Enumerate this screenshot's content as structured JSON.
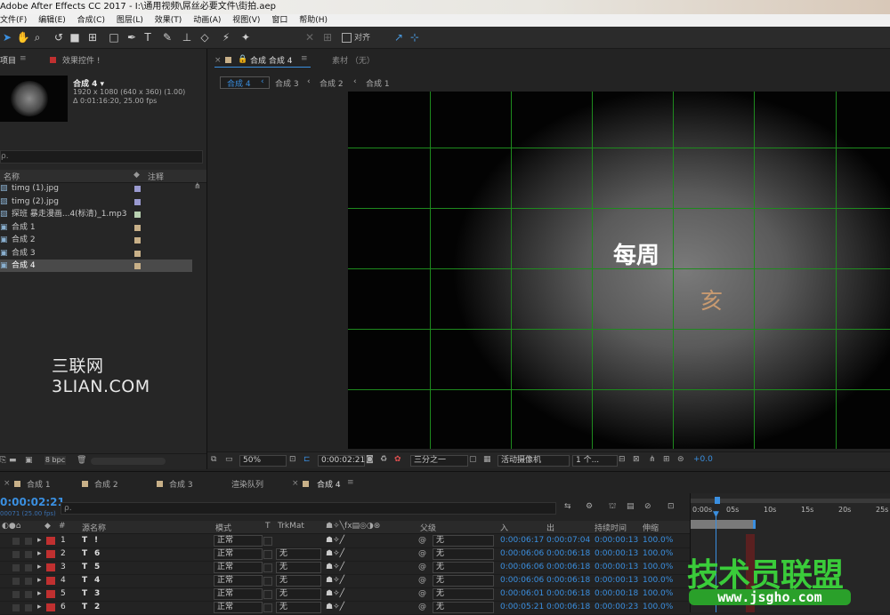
{
  "window": {
    "title": "Adobe After Effects CC 2017 - I:\\通用视频\\屌丝必要文件\\街拍.aep"
  },
  "menu": [
    "文件(F)",
    "编辑(E)",
    "合成(C)",
    "图层(L)",
    "效果(T)",
    "动画(A)",
    "视图(V)",
    "窗口",
    "帮助(H)"
  ],
  "toolbar": {
    "align_label": "对齐"
  },
  "project": {
    "tab_project": "项目",
    "tab_effects": "效果控件 !",
    "comp_name": "合成 4 ▾",
    "comp_size": "1920 x 1080  (640 x 360) (1.00)",
    "comp_duration": "Δ 0:01:16:20, 25.00 fps",
    "search_placeholder": "ρ.",
    "col_name": "名称",
    "col_comment": "注释",
    "items": [
      {
        "name": "timg (1).jpg",
        "color": "#9a9ad0"
      },
      {
        "name": "timg (2).jpg",
        "color": "#9a9ad0"
      },
      {
        "name": "探班 暴走漫画...4(标清)_1.mp3",
        "color": "#b8d0b0"
      },
      {
        "name": "合成 1",
        "color": "#c8b088"
      },
      {
        "name": "合成 2",
        "color": "#c8b088"
      },
      {
        "name": "合成 3",
        "color": "#c8b088"
      },
      {
        "name": "合成 4",
        "color": "#c8b088"
      }
    ],
    "bpc": "8 bpc"
  },
  "watermark": "三联网 3LIAN.COM",
  "viewer": {
    "tab_comp": "合成 合成 4",
    "tab_footage": "素材 （无）",
    "breadcrumbs": [
      "合成 4",
      "合成 3",
      "合成 2",
      "合成 1"
    ],
    "text_main": "每周",
    "text_sub": "亥",
    "zoom": "50%",
    "timecode": "0:00:02:21",
    "resolution": "三分之一",
    "camera": "活动摄像机",
    "views": "1 个...",
    "exposure": "+0.0"
  },
  "timeline": {
    "tabs": [
      "合成 1",
      "合成 2",
      "合成 3",
      "渲染队列",
      "合成 4"
    ],
    "timecode": "0:00:02:21",
    "fps_note": "00071 (25.00 fps)",
    "search_placeholder": "ρ.",
    "columns": {
      "num": "#",
      "source": "源名称",
      "mode": "模式",
      "t": "T",
      "trkmat": "TrkMat",
      "parent": "父级",
      "in": "入",
      "out": "出",
      "duration": "持续时间",
      "stretch": "伸缩"
    },
    "ruler": [
      "0:00s",
      "05s",
      "10s",
      "15s",
      "20s",
      "25s"
    ],
    "layers": [
      {
        "num": "1",
        "name": "!",
        "mode": "正常",
        "trkmat": "",
        "parent": "无",
        "in": "0:00:06:17",
        "out": "0:00:07:04",
        "duration": "0:00:00:13",
        "stretch": "100.0%"
      },
      {
        "num": "2",
        "name": "6",
        "mode": "正常",
        "trkmat": "无",
        "parent": "无",
        "in": "0:00:06:06",
        "out": "0:00:06:18",
        "duration": "0:00:00:13",
        "stretch": "100.0%"
      },
      {
        "num": "3",
        "name": "5",
        "mode": "正常",
        "trkmat": "无",
        "parent": "无",
        "in": "0:00:06:06",
        "out": "0:00:06:18",
        "duration": "0:00:00:13",
        "stretch": "100.0%"
      },
      {
        "num": "4",
        "name": "4",
        "mode": "正常",
        "trkmat": "无",
        "parent": "无",
        "in": "0:00:06:06",
        "out": "0:00:06:18",
        "duration": "0:00:00:13",
        "stretch": "100.0%"
      },
      {
        "num": "5",
        "name": "3",
        "mode": "正常",
        "trkmat": "无",
        "parent": "无",
        "in": "0:00:06:01",
        "out": "0:00:06:18",
        "duration": "0:00:00:18",
        "stretch": "100.0%"
      },
      {
        "num": "6",
        "name": "2",
        "mode": "正常",
        "trkmat": "无",
        "parent": "无",
        "in": "0:00:05:21",
        "out": "0:00:06:18",
        "duration": "0:00:00:23",
        "stretch": "100.0%"
      }
    ]
  },
  "badge": {
    "title": "技术员联盟",
    "url": "www.jsgho.com"
  }
}
